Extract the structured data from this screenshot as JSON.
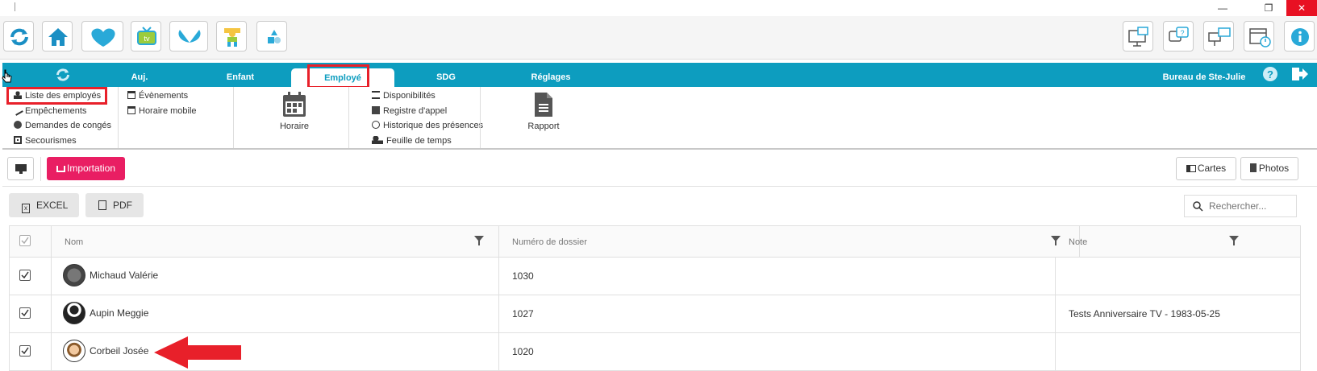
{
  "window": {
    "minimize": "—",
    "maximize": "❐",
    "close": "✕"
  },
  "toolbar": {
    "left_icons": [
      "refresh-icon",
      "home-icon",
      "heart-icon",
      "tv-icon",
      "butterfly-icon",
      "child-icon",
      "shapes-icon"
    ],
    "right_icons": [
      "remote-desktop-mail-icon",
      "help-chat-icon",
      "screen-switch-icon",
      "calendar-clock-icon",
      "info-icon"
    ]
  },
  "nav": {
    "tabs": [
      "Auj.",
      "Enfant",
      "Employé",
      "SDG",
      "Réglages"
    ],
    "active": "Employé",
    "location": "Bureau de Ste-Julie"
  },
  "submenu": {
    "col1": [
      "Liste des employés",
      "Empêchements",
      "Demandes de congés",
      "Secourismes"
    ],
    "col2": [
      "Évènements",
      "Horaire mobile"
    ],
    "big1": "Horaire",
    "col3": [
      "Disponibilités",
      "Registre d'appel",
      "Historique des présences",
      "Feuille de temps"
    ],
    "big2": "Rapport"
  },
  "actions": {
    "import": "Importation",
    "cards": "Cartes",
    "photos": "Photos",
    "excel": "EXCEL",
    "pdf": "PDF",
    "search_placeholder": "Rechercher..."
  },
  "table": {
    "headers": [
      "Nom",
      "Numéro de dossier",
      "Note"
    ],
    "rows": [
      {
        "name": "Michaud Valérie",
        "file": "1030",
        "note": ""
      },
      {
        "name": "Aupin Meggie",
        "file": "1027",
        "note": "Tests Anniversaire TV - 1983-05-25"
      },
      {
        "name": "Corbeil Josée",
        "file": "1020",
        "note": ""
      }
    ]
  },
  "colors": {
    "nav": "#0d9dbf",
    "accent": "#e91e63",
    "highlight": "#e8202a"
  }
}
